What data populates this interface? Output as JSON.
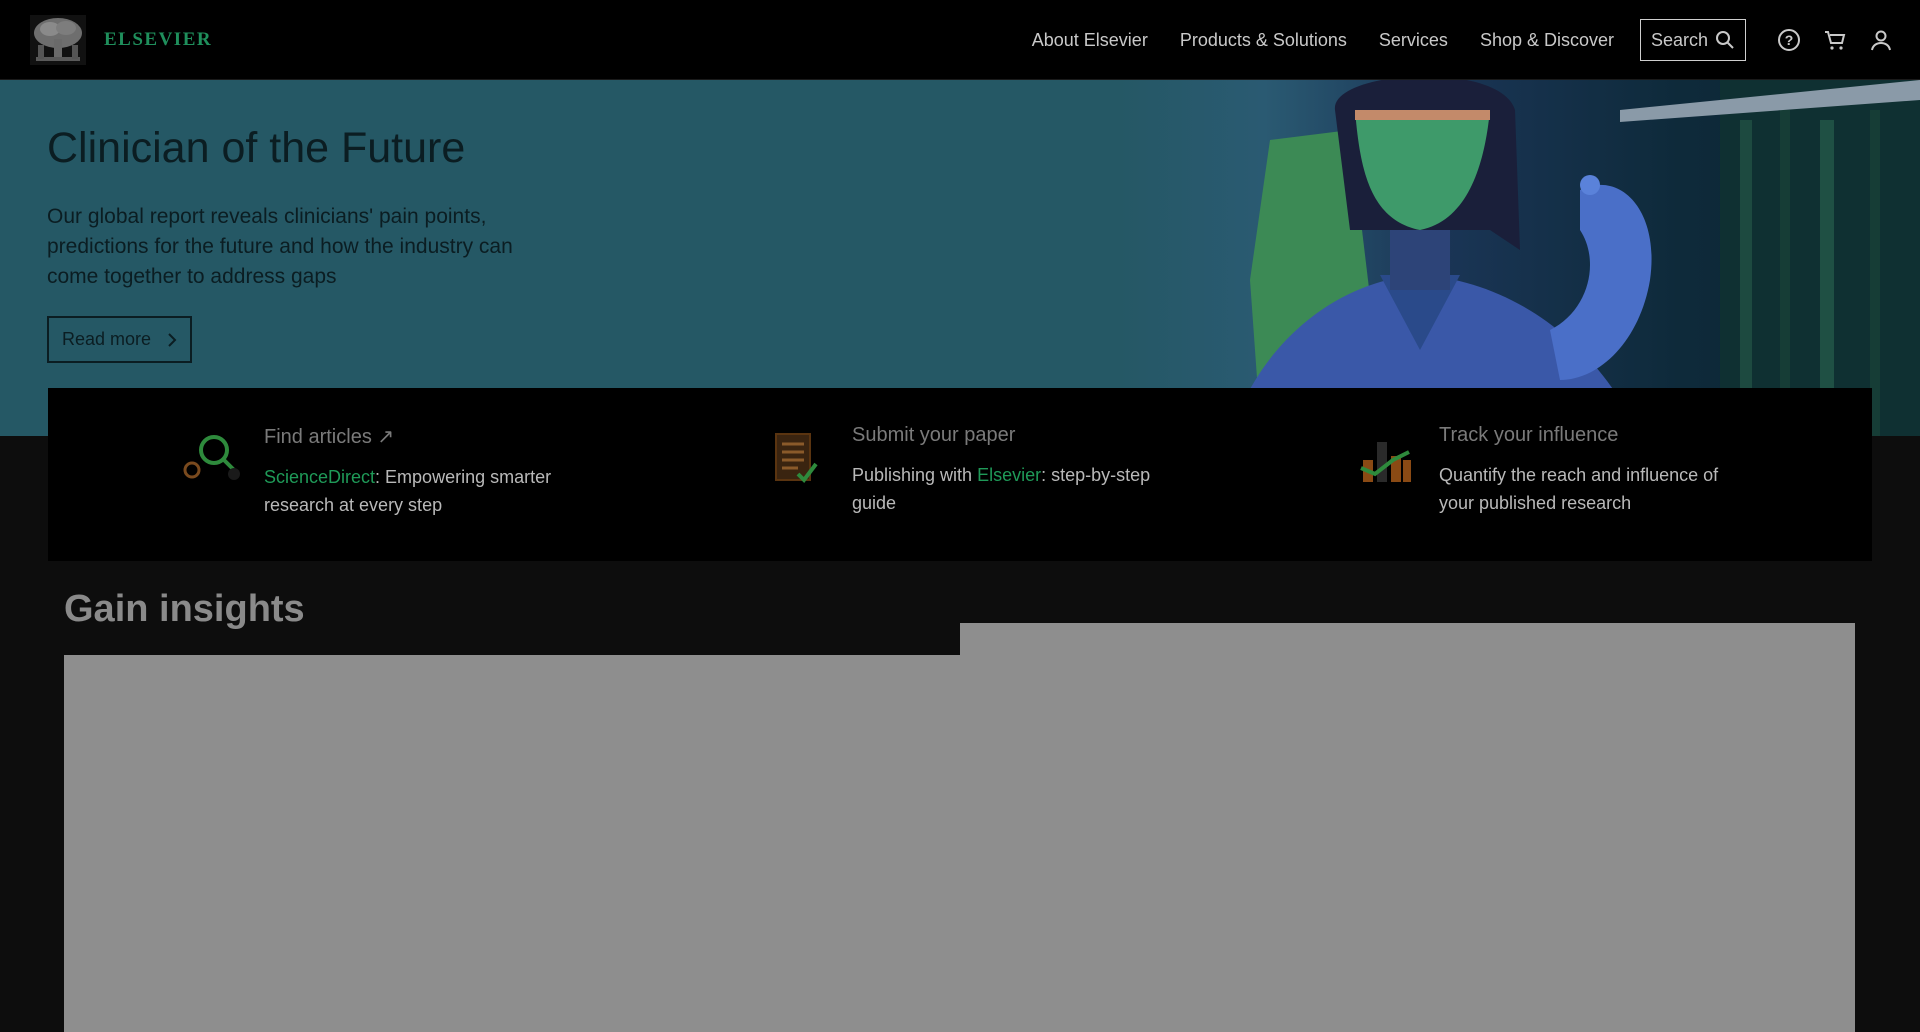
{
  "header": {
    "logo_text": "ELSEVIER",
    "nav": [
      "About Elsevier",
      "Products & Solutions",
      "Services",
      "Shop & Discover"
    ],
    "search_label": "Search",
    "icons": [
      "help-icon",
      "cart-icon",
      "user-icon"
    ]
  },
  "hero": {
    "title": "Clinician of the Future",
    "description": "Our global report reveals clinicians' pain points, predictions for the future and how the industry can come together to address gaps",
    "button_label": "Read more",
    "bg_color": "#255865"
  },
  "quick_links": [
    {
      "title": "Find articles",
      "title_suffix": "↗",
      "desc_highlight": "ScienceDirect",
      "desc_rest": ": Empowering smarter research at every step",
      "icon": "magnifier-icon"
    },
    {
      "title": "Submit your paper",
      "desc_pre": "Publishing with ",
      "desc_highlight": "Elsevier",
      "desc_rest": ": step-by-step guide",
      "icon": "document-check-icon"
    },
    {
      "title": "Track your influence",
      "desc_rest": "Quantify the reach and influence of your published research",
      "icon": "bar-chart-icon"
    }
  ],
  "insights": {
    "title": "Gain insights"
  },
  "colors": {
    "accent_green": "#1f9a58",
    "header_bg": "#000000",
    "page_bg": "#0d0d0d"
  }
}
